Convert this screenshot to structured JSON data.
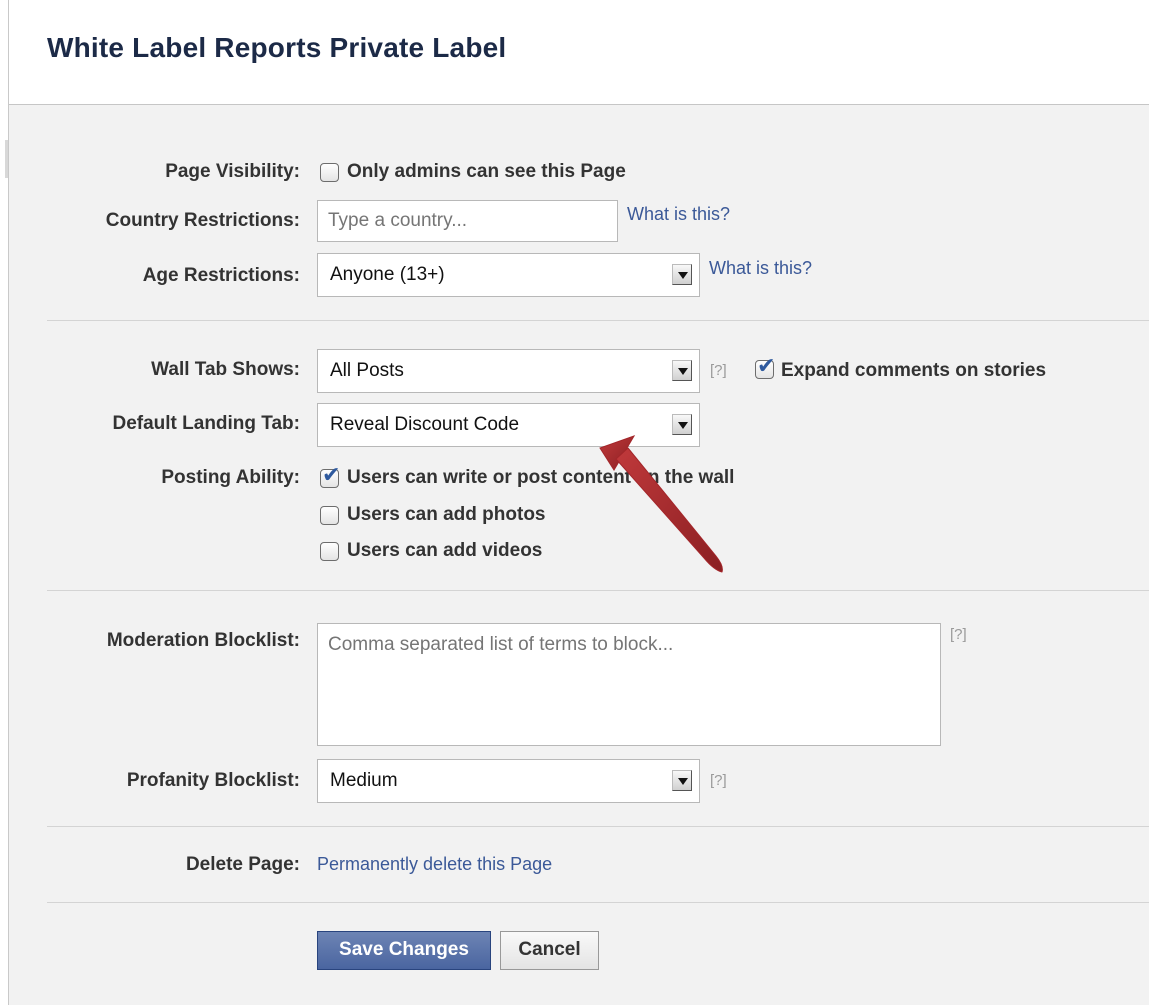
{
  "header": {
    "title": "White Label Reports Private Label"
  },
  "page_visibility": {
    "label": "Page Visibility:",
    "checkbox_label": "Only admins can see this Page",
    "checked": false
  },
  "country_restrictions": {
    "label": "Country Restrictions:",
    "placeholder": "Type a country...",
    "help_link": "What is this?"
  },
  "age_restrictions": {
    "label": "Age Restrictions:",
    "selected": "Anyone (13+)",
    "help_link": "What is this?"
  },
  "wall_tab": {
    "label": "Wall Tab Shows:",
    "selected": "All Posts",
    "help": "[?]",
    "expand_label": "Expand comments on stories",
    "expand_checked": true
  },
  "default_landing_tab": {
    "label": "Default Landing Tab:",
    "selected": "Reveal Discount Code"
  },
  "posting_ability": {
    "label": "Posting Ability:",
    "options": [
      {
        "label": "Users can write or post content on the wall",
        "checked": true
      },
      {
        "label": "Users can add photos",
        "checked": false
      },
      {
        "label": "Users can add videos",
        "checked": false
      }
    ]
  },
  "moderation_blocklist": {
    "label": "Moderation Blocklist:",
    "placeholder": "Comma separated list of terms to block...",
    "help": "[?]"
  },
  "profanity_blocklist": {
    "label": "Profanity Blocklist:",
    "selected": "Medium",
    "help": "[?]"
  },
  "delete_page": {
    "label": "Delete Page:",
    "link": "Permanently delete this Page"
  },
  "actions": {
    "save_label": "Save Changes",
    "cancel_label": "Cancel"
  },
  "annotation": {
    "arrow_color": "#a3262a"
  }
}
